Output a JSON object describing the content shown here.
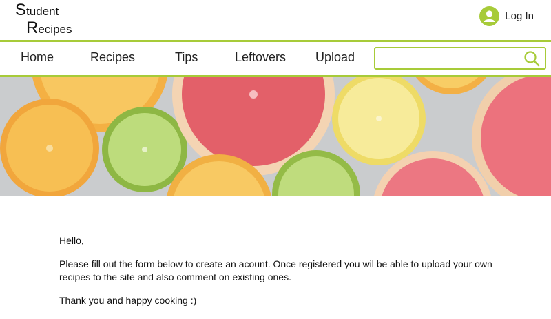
{
  "logo": {
    "line1_cap": "S",
    "line1_rest": "tudent",
    "line2_cap": "R",
    "line2_rest": "ecipes"
  },
  "header": {
    "login_label": "Log In",
    "login_icon": "user-avatar-icon"
  },
  "nav": {
    "items": [
      {
        "label": "Home"
      },
      {
        "label": "Recipes"
      },
      {
        "label": "Tips"
      },
      {
        "label": "Leftovers"
      },
      {
        "label": "Upload"
      }
    ]
  },
  "search": {
    "value": "",
    "placeholder": "",
    "icon": "search-icon"
  },
  "hero": {
    "icon": "citrus-slices-banner"
  },
  "content": {
    "greeting": "Hello,",
    "intro": "Please fill out the form below to create an acount. Once registered  you wil be able to upload your own recipes to the site and also comment on existing ones.",
    "closing": "Thank you and happy cooking :)"
  },
  "colors": {
    "accent": "#a7cb39",
    "text": "#111111",
    "background": "#ffffff"
  }
}
